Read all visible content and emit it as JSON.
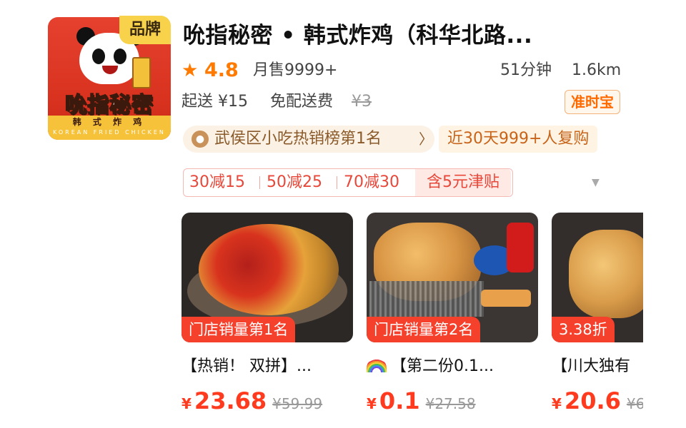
{
  "shop": {
    "name": "吮指秘密 • 韩式炸鸡（科华北路...",
    "brand_tag": "品牌",
    "logo_text_main": "吮指秘密",
    "logo_text_sub": "韩 式 炸 鸡",
    "logo_text_en": "KOREAN FRIED CHICKEN",
    "rating_icon": "star-icon",
    "rating": "4.8",
    "monthly_sales": "月售9999+",
    "delivery_time": "51分钟",
    "distance": "1.6km",
    "min_order": "起送 ¥15",
    "delivery_fee": "免配送费",
    "original_delivery_fee": "¥3",
    "ontime_badge": "准时宝",
    "rank_text": "武侯区小吃热销榜第1名",
    "rank_chevron": "〉",
    "repurchase_text": "近30天999+人复购"
  },
  "coupons": [
    "30减15",
    "50减25",
    "70减30",
    "含5元津贴"
  ],
  "products": [
    {
      "badge": "门店销量第1名",
      "title": "【热销！ 双拼】...",
      "currency": "¥",
      "price": "23.68",
      "original_price": "¥59.99",
      "has_rainbow": false
    },
    {
      "badge": "门店销量第2名",
      "title": "【第二份0.1...",
      "currency": "¥",
      "price": "0.1",
      "original_price": "¥27.58",
      "has_rainbow": true
    },
    {
      "badge": "3.38折",
      "title": "【川大独有",
      "currency": "¥",
      "price": "20.6",
      "original_price": "¥6",
      "has_rainbow": false
    }
  ],
  "colors": {
    "accent_orange": "#ff7a00",
    "price_red": "#ff3b1f",
    "badge_red": "#f5402c",
    "brand_yellow": "#f7d24a"
  }
}
